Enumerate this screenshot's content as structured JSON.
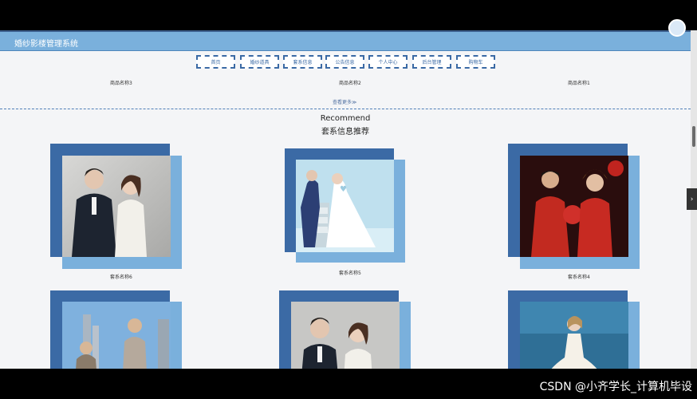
{
  "header": {
    "title": "婚纱影楼管理系统"
  },
  "nav": [
    {
      "label": "首页"
    },
    {
      "label": "婚纱道具"
    },
    {
      "label": "套系信息"
    },
    {
      "label": "公告信息"
    },
    {
      "label": "个人中心"
    },
    {
      "label": "后台管理"
    },
    {
      "label": "购物车"
    }
  ],
  "products": [
    "商品名称3",
    "商品名称2",
    "商品名称1"
  ],
  "more_label": "查看更多≫",
  "recommend": {
    "en": "Recommend",
    "zh": "套系信息推荐"
  },
  "packages": [
    {
      "caption": "套系名称6",
      "photo": "couple-suit-photo"
    },
    {
      "caption": "套系名称5",
      "photo": "couple-studio-photo"
    },
    {
      "caption": "套系名称4",
      "photo": "chinese-wedding-photo"
    },
    {
      "caption": "",
      "photo": "city-couple-photo"
    },
    {
      "caption": "",
      "photo": "couple-suit-photo-2"
    },
    {
      "caption": "",
      "photo": "bride-gown-photo"
    }
  ],
  "watermark": "CSDN @小齐学长_计算机毕设",
  "colors": {
    "accent": "#3b6aa5",
    "light_accent": "#7ab0dc",
    "page_bg": "#f4f5f7"
  }
}
